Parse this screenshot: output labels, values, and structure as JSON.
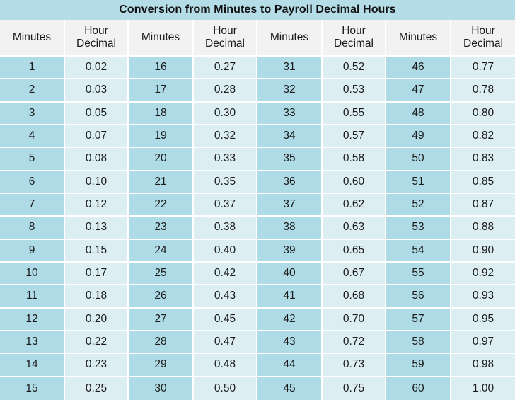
{
  "title": "Conversion from Minutes to Payroll Decimal Hours",
  "colors": {
    "title_band": "#b4dde8",
    "header_bg": "#f2f2f2",
    "minutes_bg": "#aedbe6",
    "decimal_bg": "#ddeef3",
    "gridline": "#ffffff",
    "text": "#1a1a1a"
  },
  "headers": {
    "minutes": "Minutes",
    "hour_line1": "Hour",
    "hour_line2": "Decimal"
  },
  "column_groups": 4,
  "row_count": 15,
  "chart_data": {
    "type": "table",
    "title": "Conversion from Minutes to Payroll Decimal Hours",
    "columns": [
      "Minutes",
      "Hour Decimal",
      "Minutes",
      "Hour Decimal",
      "Minutes",
      "Hour Decimal",
      "Minutes",
      "Hour Decimal"
    ],
    "rows": [
      [
        "1",
        "0.02",
        "16",
        "0.27",
        "31",
        "0.52",
        "46",
        "0.77"
      ],
      [
        "2",
        "0.03",
        "17",
        "0.28",
        "32",
        "0.53",
        "47",
        "0.78"
      ],
      [
        "3",
        "0.05",
        "18",
        "0.30",
        "33",
        "0.55",
        "48",
        "0.80"
      ],
      [
        "4",
        "0.07",
        "19",
        "0.32",
        "34",
        "0.57",
        "49",
        "0.82"
      ],
      [
        "5",
        "0.08",
        "20",
        "0.33",
        "35",
        "0.58",
        "50",
        "0.83"
      ],
      [
        "6",
        "0.10",
        "21",
        "0.35",
        "36",
        "0.60",
        "51",
        "0.85"
      ],
      [
        "7",
        "0.12",
        "22",
        "0.37",
        "37",
        "0.62",
        "52",
        "0.87"
      ],
      [
        "8",
        "0.13",
        "23",
        "0.38",
        "38",
        "0.63",
        "53",
        "0.88"
      ],
      [
        "9",
        "0.15",
        "24",
        "0.40",
        "39",
        "0.65",
        "54",
        "0.90"
      ],
      [
        "10",
        "0.17",
        "25",
        "0.42",
        "40",
        "0.67",
        "55",
        "0.92"
      ],
      [
        "11",
        "0.18",
        "26",
        "0.43",
        "41",
        "0.68",
        "56",
        "0.93"
      ],
      [
        "12",
        "0.20",
        "27",
        "0.45",
        "42",
        "0.70",
        "57",
        "0.95"
      ],
      [
        "13",
        "0.22",
        "28",
        "0.47",
        "43",
        "0.72",
        "58",
        "0.97"
      ],
      [
        "14",
        "0.23",
        "29",
        "0.48",
        "44",
        "0.73",
        "59",
        "0.98"
      ],
      [
        "15",
        "0.25",
        "30",
        "0.50",
        "45",
        "0.75",
        "60",
        "1.00"
      ]
    ]
  }
}
